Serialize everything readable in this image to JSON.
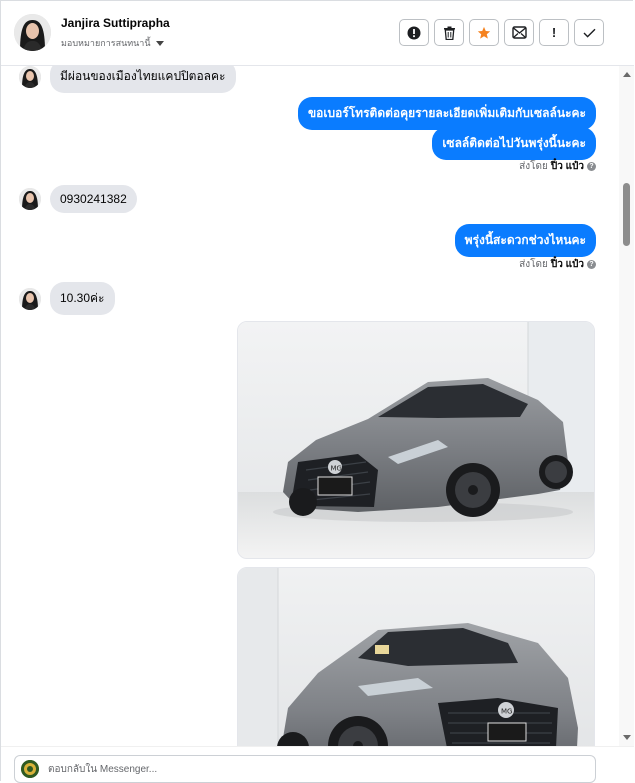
{
  "header": {
    "contact_name": "Janjira Suttiprapha",
    "assign_label": "มอบหมายการสนทนานี้",
    "action_icons": [
      "alert-circle-icon",
      "trash-icon",
      "star-icon",
      "mark-unread-icon",
      "important-icon",
      "check-icon"
    ],
    "important_glyph": "!",
    "star_color": "#f5821f"
  },
  "thread": {
    "messages": [
      {
        "dir": "in",
        "text": "มีผ่อนของเมืองไทยแคปปิตอลคะ"
      },
      {
        "dir": "out",
        "text": "ขอเบอร์โทรติดต่อคุยรายละเอียดเพิ่มเติมกับเซลล์นะคะ"
      },
      {
        "dir": "out",
        "text": "เซลล์ติดต่อไปวันพรุ่งนี้นะคะ"
      },
      {
        "dir": "in",
        "text": "0930241382"
      },
      {
        "dir": "out",
        "text": "พรุ่งนี้สะดวกช่วงไหนคะ"
      },
      {
        "dir": "in",
        "text": "10.30ค่ะ"
      }
    ],
    "sent_by_1": {
      "prefix": "ส่งโดย",
      "agent": "ปิ๋ว แป๋ว",
      "help": "?"
    },
    "sent_by_2": {
      "prefix": "ส่งโดย",
      "agent": "ปิ๋ว แป๋ว",
      "help": "?"
    },
    "photos": [
      "car-photo-front-angle",
      "car-photo-front"
    ],
    "bubble_color": "#0a7cff"
  },
  "composer": {
    "placeholder": "ตอบกลับใน Messenger..."
  }
}
